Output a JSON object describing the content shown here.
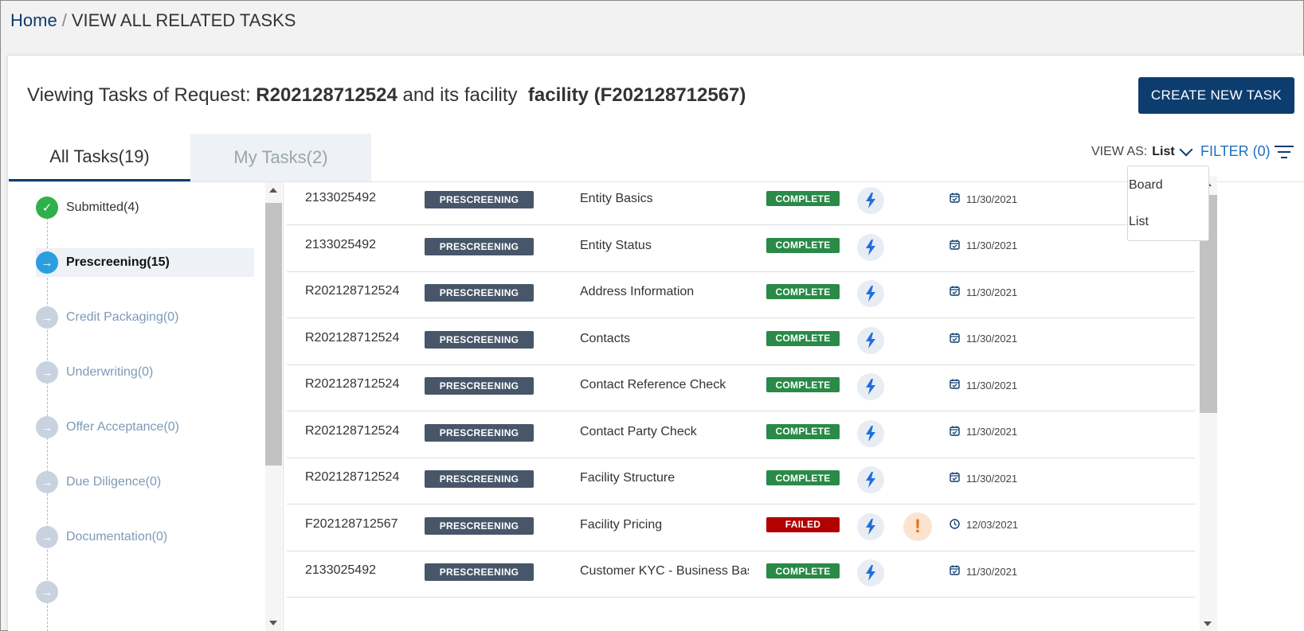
{
  "breadcrumb": {
    "home": "Home",
    "separator": "/",
    "current": "VIEW ALL RELATED TASKS"
  },
  "header": {
    "prefix": "Viewing Tasks of Request:",
    "request_id": "R202128712524",
    "middle": "and its facility",
    "facility": "facility (F202128712567)",
    "create_button": "CREATE NEW TASK"
  },
  "tabs": {
    "all": "All Tasks(19)",
    "mine": "My Tasks(2)"
  },
  "view_as": {
    "label": "VIEW AS:",
    "value": "List",
    "options": [
      "Board",
      "List"
    ]
  },
  "filter": {
    "label": "FILTER (0)"
  },
  "stages": [
    {
      "label": "Submitted(4)",
      "state": "done"
    },
    {
      "label": "Prescreening(15)",
      "state": "active"
    },
    {
      "label": "Credit Packaging(0)",
      "state": "pending"
    },
    {
      "label": "Underwriting(0)",
      "state": "pending"
    },
    {
      "label": "Offer Acceptance(0)",
      "state": "pending"
    },
    {
      "label": "Due Diligence(0)",
      "state": "pending"
    },
    {
      "label": "Documentation(0)",
      "state": "pending"
    }
  ],
  "tasks": [
    {
      "id": "2133025492",
      "stage": "PRESCREENING",
      "name": "Entity Basics",
      "status": "COMPLETE",
      "warning": false,
      "date_icon": "calendar-check-icon",
      "date": "11/30/2021"
    },
    {
      "id": "2133025492",
      "stage": "PRESCREENING",
      "name": "Entity Status",
      "status": "COMPLETE",
      "warning": false,
      "date_icon": "calendar-check-icon",
      "date": "11/30/2021"
    },
    {
      "id": "R202128712524",
      "stage": "PRESCREENING",
      "name": "Address Information",
      "status": "COMPLETE",
      "warning": false,
      "date_icon": "calendar-check-icon",
      "date": "11/30/2021"
    },
    {
      "id": "R202128712524",
      "stage": "PRESCREENING",
      "name": "Contacts",
      "status": "COMPLETE",
      "warning": false,
      "date_icon": "calendar-check-icon",
      "date": "11/30/2021"
    },
    {
      "id": "R202128712524",
      "stage": "PRESCREENING",
      "name": "Contact Reference Check",
      "status": "COMPLETE",
      "warning": false,
      "date_icon": "calendar-check-icon",
      "date": "11/30/2021"
    },
    {
      "id": "R202128712524",
      "stage": "PRESCREENING",
      "name": "Contact Party Check",
      "status": "COMPLETE",
      "warning": false,
      "date_icon": "calendar-check-icon",
      "date": "11/30/2021"
    },
    {
      "id": "R202128712524",
      "stage": "PRESCREENING",
      "name": "Facility Structure",
      "status": "COMPLETE",
      "warning": false,
      "date_icon": "calendar-check-icon",
      "date": "11/30/2021"
    },
    {
      "id": "F202128712567",
      "stage": "PRESCREENING",
      "name": "Facility Pricing",
      "status": "FAILED",
      "warning": true,
      "date_icon": "clock-icon",
      "date": "12/03/2021"
    },
    {
      "id": "2133025492",
      "stage": "PRESCREENING",
      "name": "Customer KYC - Business Basics",
      "status": "COMPLETE",
      "warning": false,
      "date_icon": "calendar-check-icon",
      "date": "11/30/2021"
    }
  ],
  "colors": {
    "primary": "#0d3d6e",
    "link": "#1f6fbf",
    "stage_badge": "#475669",
    "complete": "#2a8a48",
    "failed": "#b30000",
    "done_stage": "#2fb04a",
    "active_stage": "#2a9fe0"
  }
}
